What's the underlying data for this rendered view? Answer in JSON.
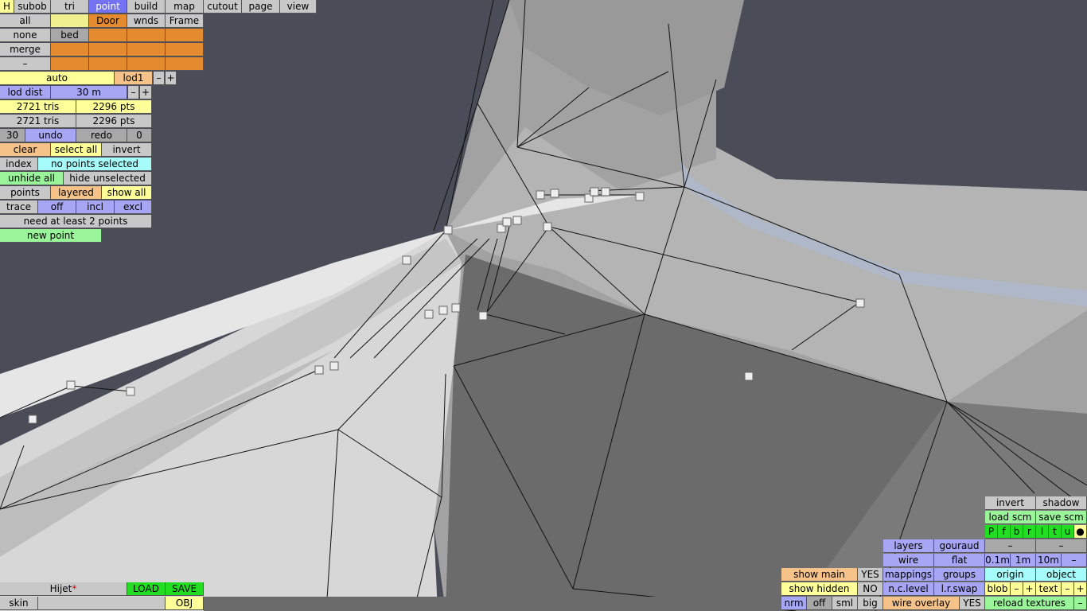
{
  "tabs": [
    "H",
    "subob",
    "tri",
    "point",
    "build",
    "map",
    "cutout",
    "page",
    "view"
  ],
  "subobj": {
    "all": "all",
    "none": "none",
    "merge": "merge",
    "dash": "–",
    "bed": "bed",
    "door": "Door",
    "wnds": "wnds",
    "frame": "Frame"
  },
  "lod": {
    "auto": "auto",
    "lod1": "lod1",
    "minus": "–",
    "plus": "+",
    "dist_label": "lod dist",
    "dist_value": "30 m"
  },
  "stats": {
    "tris1": "2721 tris",
    "pts1": "2296 pts",
    "tris2": "2721 tris",
    "pts2": "2296 pts"
  },
  "undo": {
    "count": "30",
    "undo": "undo",
    "redo": "redo",
    "redo_count": "0"
  },
  "select": {
    "clear": "clear",
    "select_all": "select all",
    "invert": "invert"
  },
  "index": {
    "label": "index",
    "status": "no points selected"
  },
  "hide": {
    "unhide_all": "unhide all",
    "hide_unselected": "hide unselected"
  },
  "points": {
    "points": "points",
    "layered": "layered",
    "show_all": "show all"
  },
  "trace": {
    "trace": "trace",
    "off": "off",
    "incl": "incl",
    "excl": "excl"
  },
  "msg": {
    "need": "need at least 2 points",
    "new_point": "new point"
  },
  "file": {
    "name": "Hijet",
    "star": "*",
    "load": "LOAD",
    "save": "SAVE",
    "skin": "skin",
    "obj": "OBJ"
  },
  "view_opts": {
    "show_main": "show main",
    "show_main_val": "YES",
    "show_hidden": "show hidden",
    "show_hidden_val": "NO",
    "nrm": "nrm",
    "off": "off",
    "sml": "sml",
    "big": "big",
    "layers": "layers",
    "gouraud": "gouraud",
    "wire": "wire",
    "flat": "flat",
    "mappings": "mappings",
    "groups": "groups",
    "nc_level": "n.c.level",
    "lr_swap": "l.r.swap",
    "wire_overlay": "wire overlay",
    "wire_overlay_val": "YES",
    "invert": "invert",
    "shadow": "shadow",
    "load_scm": "load scm",
    "save_scm": "save scm",
    "letters": [
      "P",
      "f",
      "b",
      "r",
      "l",
      "t",
      "u",
      "●"
    ],
    "dash1": "–",
    "dash2": "–",
    "g01": "0.1m",
    "g1": "1m",
    "g10": "10m",
    "gminus": "–",
    "origin": "origin",
    "object": "object",
    "blob": "blob",
    "text": "text",
    "pm_minus": "–",
    "pm_plus": "+",
    "reload": "reload textures",
    "rminus": "–"
  }
}
